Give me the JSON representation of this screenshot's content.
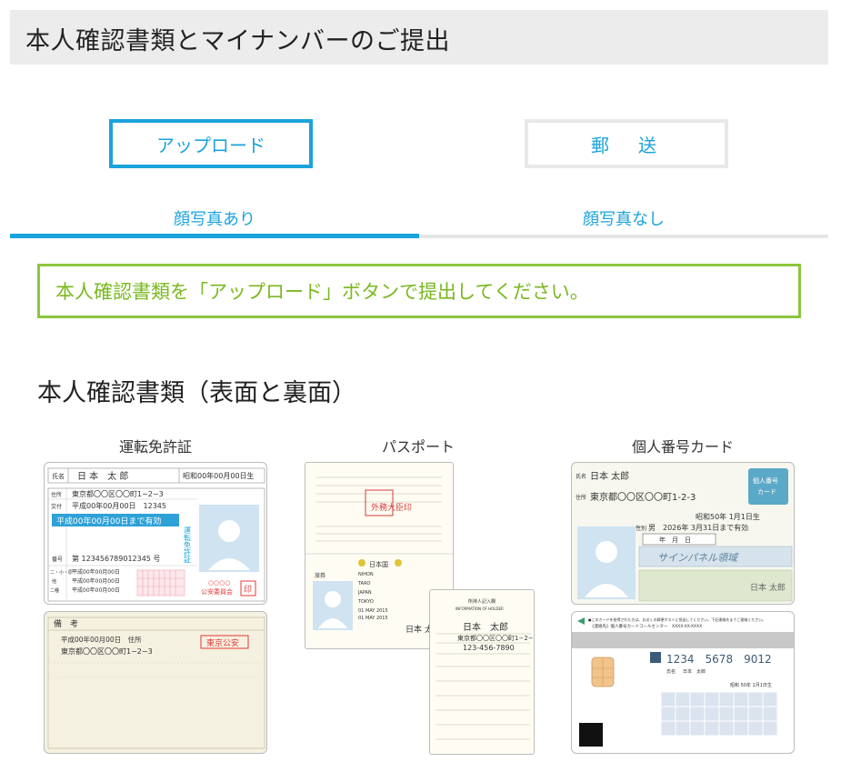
{
  "header": {
    "title": "本人確認書類とマイナンバーのご提出"
  },
  "submit_modes": {
    "upload_label": "アップロード",
    "mail_label": "郵　送"
  },
  "tabs": {
    "with_photo": "顔写真あり",
    "without_photo": "顔写真なし"
  },
  "notice": {
    "text": "本人確認書類を「アップロード」ボタンで提出してください。"
  },
  "section": {
    "title": "本人確認書類（表面と裏面）"
  },
  "documents": [
    {
      "label": "運転免許証"
    },
    {
      "label": "パスポート"
    },
    {
      "label": "個人番号カード"
    }
  ],
  "license": {
    "name_label": "氏名",
    "name": "日 本　太 郎",
    "birth": "昭和00年00月00日生",
    "address_label": "住所",
    "address": "東京都〇〇区〇〇町1−2−3",
    "issue_label": "交付",
    "issue": "平成00年00月00日　12345",
    "validity": "平成00年00月00日まで有効",
    "vertical_label": "運転免許証",
    "number_label": "番号",
    "number": "第 123456789012345 号",
    "row1_label": "二・小・原",
    "row2_label": "他",
    "row3_label": "二種",
    "date_row": "平成00年00月00日",
    "commission_dots": "○○○○",
    "commission": "公安委員会",
    "seal": "印"
  },
  "license_back": {
    "remarks_label": "備　考",
    "line1": "平成00年00月00日　住所",
    "line2": "東京都〇〇区〇〇町1−2−3",
    "stamp": "東京公安"
  },
  "passport": {
    "vertical_stamp": "外務大臣印",
    "nation": "日本国",
    "field1_label": "旅券",
    "field1_value": "TARO",
    "field2_value": "NIHON",
    "field3_value": "JAPAN",
    "field4_value": "TOKYO",
    "field5_value": "01 MAY 2015",
    "field6_value": "01 MAY 2015",
    "sign_name": "日本 太",
    "page_title": "所持人記入欄",
    "page_subtitle": "INFORMATION OF HOLDER",
    "page_name": "日本　太郎",
    "page_address": "東京都〇〇区〇〇町1−2−3",
    "page_phone": "123-456-7890"
  },
  "mynumber": {
    "name_label": "氏名",
    "name": "日本 太郎",
    "address_label": "住所",
    "address": "東京都〇〇区〇〇町1-2-3",
    "birth": "昭和50年 1月1日生",
    "sex_label": "性別",
    "sex_validity": "男　2026年 3月31日まで有効",
    "date_box": "年　月　日",
    "badge_line1": "個人番号",
    "badge_line2": "カード",
    "sign_text": "サインパネル領域",
    "sign_name": "日本 太郎",
    "back_notice1": "●このカードを拾得された方は、お近くの郵便ポストに投函してください。下記連絡先までご連絡ください。",
    "back_notice2": "《連絡先》個人番号カードコールセンター　XXXX-XX-XXXX",
    "number": "1234　5678　9012",
    "back_name_label": "氏名",
    "back_name": "日本　太郎",
    "back_birth": "昭和 50年 1月1日生"
  }
}
